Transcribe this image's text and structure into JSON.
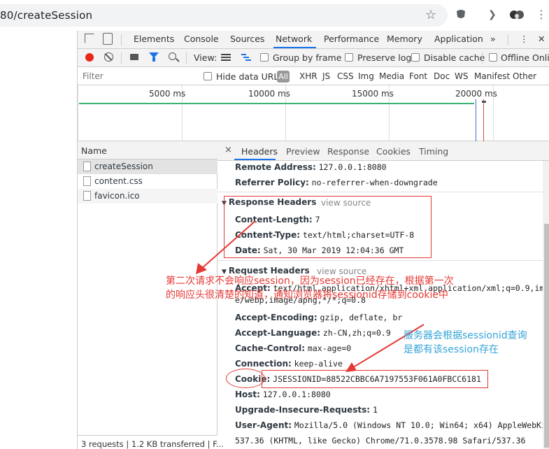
{
  "browser": {
    "url": "80/createSession"
  },
  "devtools": {
    "tabs": [
      "Elements",
      "Console",
      "Sources",
      "Network",
      "Performance",
      "Memory",
      "Application"
    ],
    "more_tabs": "»",
    "toolbar": {
      "view_label": "View:",
      "group_by_frame": "Group by frame",
      "preserve_log": "Preserve log",
      "disable_cache": "Disable cache",
      "offline": "Offline",
      "online": "Onlin"
    },
    "filter": {
      "placeholder": "Filter",
      "hide_data_urls": "Hide data URLs",
      "all": "All",
      "types": [
        "XHR",
        "JS",
        "CSS",
        "Img",
        "Media",
        "Font",
        "Doc",
        "WS",
        "Manifest",
        "Other"
      ]
    },
    "overview": {
      "ticks": [
        "5000 ms",
        "10000 ms",
        "15000 ms",
        "20000 ms"
      ]
    },
    "requests": {
      "header": "Name",
      "items": [
        "createSession",
        "content.css",
        "favicon.ico"
      ],
      "status": "3 requests | 1.2 KB transferred | F..."
    },
    "detail": {
      "close": "×",
      "tabs": [
        "Headers",
        "Preview",
        "Response",
        "Cookies",
        "Timing"
      ],
      "general": [
        {
          "key": "Remote Address:",
          "value": "127.0.0.1:8080"
        },
        {
          "key": "Referrer Policy:",
          "value": "no-referrer-when-downgrade"
        }
      ],
      "response_headers": {
        "title": "Response Headers",
        "view_source": "view source",
        "items": [
          {
            "key": "Content-Length:",
            "value": "7"
          },
          {
            "key": "Content-Type:",
            "value": "text/html;charset=UTF-8"
          },
          {
            "key": "Date:",
            "value": "Sat, 30 Mar 2019 12:04:36 GMT"
          }
        ]
      },
      "request_headers": {
        "title": "Request Headers",
        "view_source": "view source",
        "accept_key": "Accept:",
        "accept_value_1": "text/html,application/xhtml+xml,application/xml;q=0.9,im",
        "accept_value_2": "e/webp,image/apng,*/*;q=0.8",
        "items": [
          {
            "key": "Accept-Encoding:",
            "value": "gzip, deflate, br"
          },
          {
            "key": "Accept-Language:",
            "value": "zh-CN,zh;q=0.9"
          },
          {
            "key": "Cache-Control:",
            "value": "max-age=0"
          },
          {
            "key": "Connection:",
            "value": "keep-alive"
          }
        ],
        "cookie_key": "Cookie:",
        "cookie_value": "JSESSIONID=88522CBBC6A7197553F061A0FBCC6181",
        "host_key": "Host:",
        "host_value": "127.0.0.1:8080",
        "upgrade_key": "Upgrade-Insecure-Requests:",
        "upgrade_value": "1",
        "ua_key": "User-Agent:",
        "ua_value_1": "Mozilla/5.0 (Windows NT 10.0; Win64; x64) AppleWebKit",
        "ua_value_2": "537.36 (KHTML, like Gecko) Chrome/71.0.3578.98 Safari/537.36"
      }
    }
  },
  "annotations": {
    "red_note_line1": "第二次请求不会响应session，因为session已经存在，根据第一次",
    "red_note_line2": "的响应头很清楚的知道，通知浏览器将sessionid存储到cookie中",
    "blue_note_line1": "服务器会根据sessionid查询",
    "blue_note_line2": "是都有该session存在",
    "red_color": "#e53935",
    "blue_color": "#36a4d8"
  }
}
